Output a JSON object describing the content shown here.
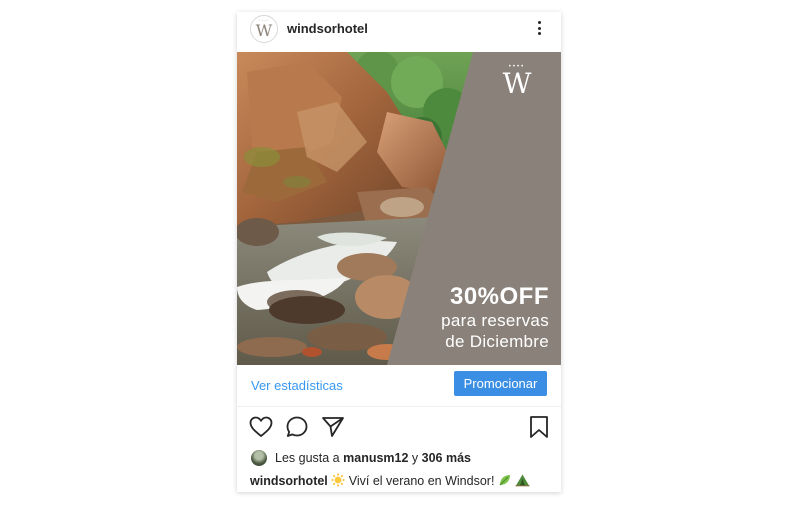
{
  "post": {
    "username": "windsorhotel",
    "avatar_letter": "W",
    "logo_letter": "W",
    "logo_dots": "••••",
    "promo_big": "30%OFF",
    "promo_line1": "para reservas",
    "promo_line2": "de Diciembre",
    "stats_link": "Ver estadísticas",
    "promote_label": "Promocionar",
    "likes_prefix": "Les gusta a",
    "likes_user": "manusm12",
    "likes_and": "y",
    "likes_count": "306 más",
    "caption_user": "windsorhotel",
    "caption_text": "Viví el verano en Windsor!"
  },
  "icons": {
    "menu": "more-vertical-icon",
    "like": "heart-icon",
    "comment": "comment-icon",
    "share": "send-icon",
    "save": "bookmark-icon",
    "sun_emoji": "sun-emoji",
    "leaf_emoji": "leaf-emoji",
    "tent_emoji": "tent-emoji"
  },
  "colors": {
    "accent_blue": "#3897f0",
    "button_blue": "#3a8fe5",
    "panel_taupe": "#8a827a"
  }
}
